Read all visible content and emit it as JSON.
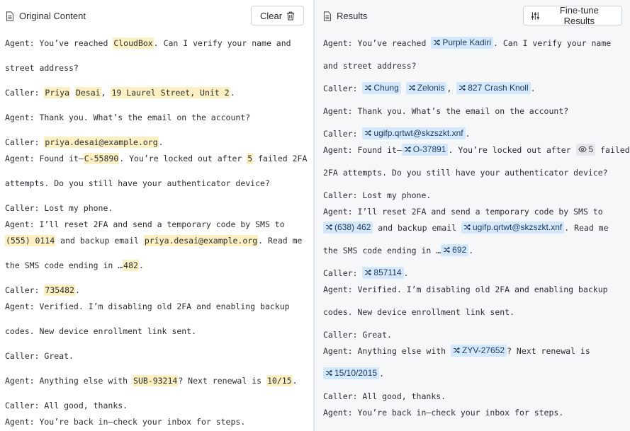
{
  "left": {
    "title": "Original Content",
    "clear_label": "Clear",
    "lines": [
      [
        {
          "t": "Agent: You’ve reached "
        },
        {
          "t": "CloudBox",
          "h": 1
        },
        {
          "t": ". Can I verify your name and"
        }
      ],
      [
        {
          "t": "street address?"
        }
      ],
      [
        {
          "t": "Caller: "
        },
        {
          "t": "Priya",
          "h": 1
        },
        {
          "t": " "
        },
        {
          "t": "Desai",
          "h": 1
        },
        {
          "t": ", "
        },
        {
          "t": "19 Laurel Street, Unit 2",
          "h": 1
        },
        {
          "t": "."
        }
      ],
      [
        {
          "t": "Agent: Thank you. What’s the email on the account?"
        }
      ],
      [
        {
          "t": "Caller: "
        },
        {
          "t": "priya.desai@example.org",
          "h": 1
        },
        {
          "t": "."
        }
      ],
      [
        {
          "t": "Agent: Found it—"
        },
        {
          "t": "C-55890",
          "h": 1
        },
        {
          "t": ". You’re locked out after "
        },
        {
          "t": "5",
          "h": 1
        },
        {
          "t": " failed 2FA"
        }
      ],
      [
        {
          "t": "attempts. Do you still have your authenticator device?"
        }
      ],
      [
        {
          "t": "Caller: Lost my phone."
        }
      ],
      [
        {
          "t": "Agent: I’ll reset 2FA and send a temporary code by SMS to"
        }
      ],
      [
        {
          "t": "(555) 0114",
          "h": 1
        },
        {
          "t": " and backup email "
        },
        {
          "t": "priya.desai@example.org",
          "h": 1
        },
        {
          "t": ". Read me"
        }
      ],
      [
        {
          "t": "the SMS code ending in …"
        },
        {
          "t": "482",
          "h": 1
        },
        {
          "t": "."
        }
      ],
      [
        {
          "t": "Caller: "
        },
        {
          "t": "735482",
          "h": 1
        },
        {
          "t": "."
        }
      ],
      [
        {
          "t": "Agent: Verified. I’m disabling old 2FA and enabling backup"
        }
      ],
      [
        {
          "t": "codes. New device enrollment link sent."
        }
      ],
      [
        {
          "t": "Caller: Great."
        }
      ],
      [
        {
          "t": "Agent: Anything else with "
        },
        {
          "t": "SUB-93214",
          "h": 1
        },
        {
          "t": "? Next renewal is "
        },
        {
          "t": "10/15",
          "h": 1
        },
        {
          "t": "."
        }
      ],
      [
        {
          "t": "Caller: All good, thanks."
        }
      ],
      [
        {
          "t": "Agent: You’re back in—check your inbox for steps."
        }
      ]
    ],
    "paragraph_breaks": [
      1,
      2,
      3,
      4,
      6,
      7,
      10,
      11,
      13,
      14,
      15,
      16
    ]
  },
  "right": {
    "title": "Results",
    "tune_label": "Fine-tune Results",
    "lines": [
      [
        {
          "t": "Agent: You’ve reached "
        },
        {
          "t": "Purple Kadiri",
          "k": "shuffle"
        },
        {
          "t": ". Can I verify your name"
        }
      ],
      [
        {
          "t": "and street address?"
        }
      ],
      [
        {
          "t": "Caller: "
        },
        {
          "t": "Chung",
          "k": "shuffle"
        },
        {
          "t": " "
        },
        {
          "t": "Zelonis",
          "k": "shuffle"
        },
        {
          "t": ", "
        },
        {
          "t": "827 Crash Knoll",
          "k": "shuffle"
        },
        {
          "t": "."
        }
      ],
      [
        {
          "t": "Agent: Thank you. What’s the email on the account?"
        }
      ],
      [
        {
          "t": "Caller: "
        },
        {
          "t": "ugifp.qrtwt@skzszkt.xnf",
          "k": "shuffle"
        },
        {
          "t": "."
        }
      ],
      [
        {
          "t": "Agent: Found it—"
        },
        {
          "t": "O-37891",
          "k": "shuffle"
        },
        {
          "t": ". You’re locked out after "
        },
        {
          "t": "5",
          "k": "eye"
        },
        {
          "t": " failed"
        }
      ],
      [
        {
          "t": "2FA attempts. Do you still have your authenticator device?"
        }
      ],
      [
        {
          "t": "Caller: Lost my phone."
        }
      ],
      [
        {
          "t": "Agent: I’ll reset 2FA and send a temporary code by SMS to"
        }
      ],
      [
        {
          "t": "(638) 462",
          "k": "shuffle"
        },
        {
          "t": " and backup email "
        },
        {
          "t": "ugifp.qrtwt@skzszkt.xnf",
          "k": "shuffle"
        },
        {
          "t": ". Read me"
        }
      ],
      [
        {
          "t": "the SMS code ending in …"
        },
        {
          "t": "692",
          "k": "shuffle"
        },
        {
          "t": "."
        }
      ],
      [
        {
          "t": "Caller: "
        },
        {
          "t": "857114",
          "k": "shuffle"
        },
        {
          "t": "."
        }
      ],
      [
        {
          "t": "Agent: Verified. I’m disabling old 2FA and enabling backup"
        }
      ],
      [
        {
          "t": "codes. New device enrollment link sent."
        }
      ],
      [
        {
          "t": "Caller: Great."
        }
      ],
      [
        {
          "t": "Agent: Anything else with "
        },
        {
          "t": "ZYV-27652",
          "k": "shuffle"
        },
        {
          "t": "? Next renewal is"
        }
      ],
      [
        {
          "t": "15/10/2015",
          "k": "shuffle"
        },
        {
          "t": "."
        }
      ],
      [
        {
          "t": "Caller: All good, thanks."
        }
      ],
      [
        {
          "t": "Agent: You’re back in—check your inbox for steps."
        }
      ]
    ],
    "paragraph_breaks": [
      1,
      2,
      3,
      4,
      6,
      7,
      10,
      11,
      13,
      14,
      16,
      17
    ]
  },
  "colors": {
    "highlight": "#fcefc2",
    "token": "#d5e8fb",
    "token_gray": "#e4e7eb",
    "right_bg": "#f6f7f9"
  },
  "icons": {
    "doc": "document-icon",
    "trash": "trash-icon",
    "sliders": "sliders-icon",
    "shuffle": "shuffle-icon",
    "eye": "eye-icon"
  }
}
